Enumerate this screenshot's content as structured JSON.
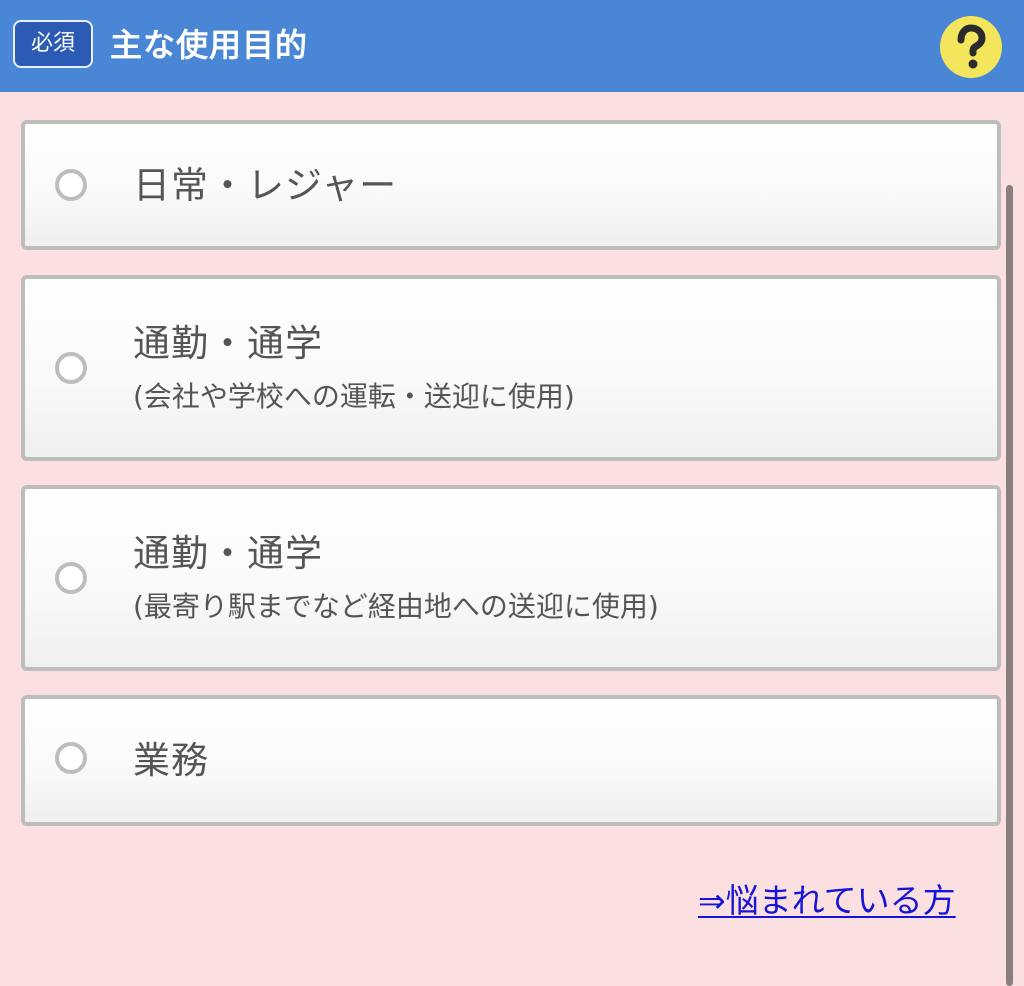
{
  "header": {
    "required_badge": "必須",
    "title": "主な使用目的",
    "help_icon": "question-mark-icon",
    "background_color": "#4a86d6",
    "help_icon_color": "#f3e55c"
  },
  "options": [
    {
      "label": "日常・レジャー",
      "sublabel": "",
      "selected": false
    },
    {
      "label": "通勤・通学",
      "sublabel": "(会社や学校への運転・送迎に使用)",
      "selected": false
    },
    {
      "label": "通勤・通学",
      "sublabel": "(最寄り駅までなど経由地への送迎に使用)",
      "selected": false
    },
    {
      "label": "業務",
      "sublabel": "",
      "selected": false
    }
  ],
  "help_link": "⇒悩まれている方",
  "colors": {
    "page_background": "#fbdfe1",
    "link": "#1515d8",
    "option_border": "#bdbdbd"
  }
}
